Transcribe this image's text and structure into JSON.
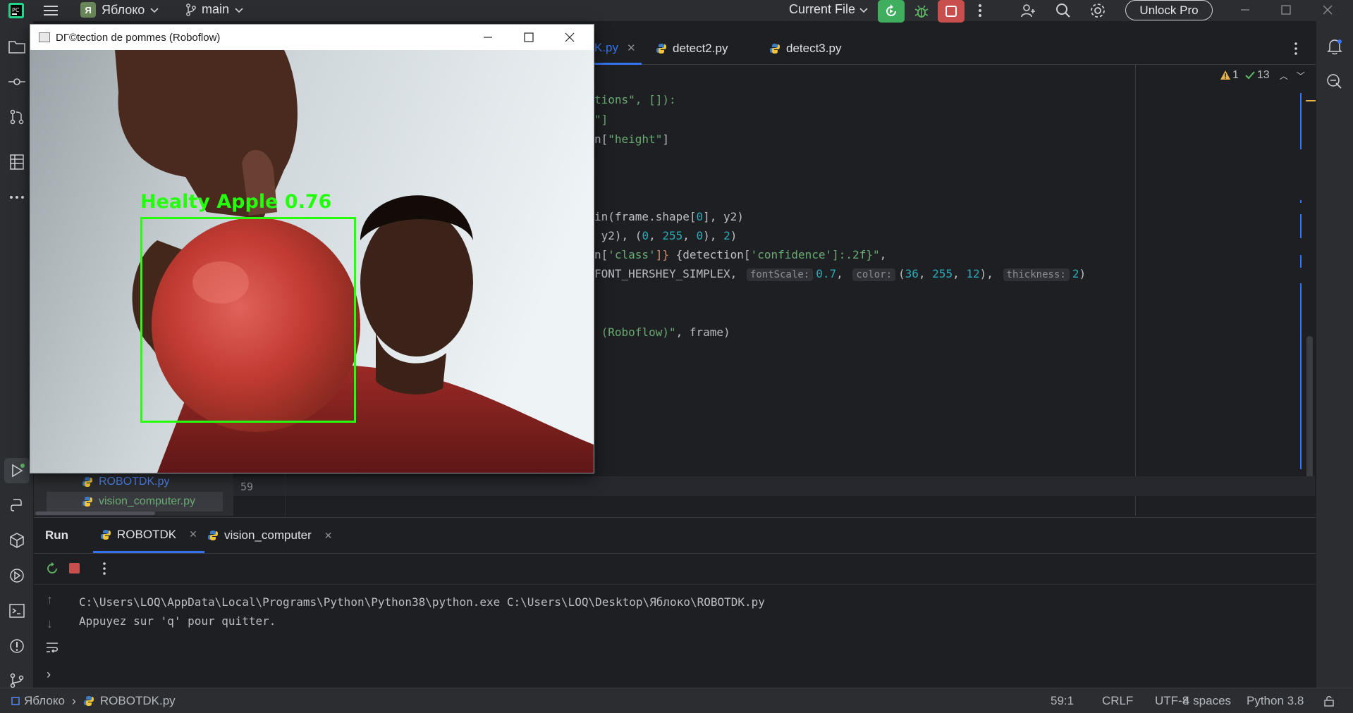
{
  "titlebar": {
    "project_initial": "Я",
    "project_name": "Яблоко",
    "branch": "main",
    "run_config": "Current File",
    "unlock_label": "Unlock Pro"
  },
  "editor": {
    "tabs": [
      {
        "label": "K.py"
      },
      {
        "label": "detect2.py"
      },
      {
        "label": "detect3.py"
      }
    ],
    "inspections": {
      "warnings": "1",
      "ok": "13"
    },
    "current_line_number": "59",
    "code": {
      "l1_a": "tions\", []):",
      "l2_a": "\"]",
      "l3_a": "n[",
      "l3_b": "\"height\"",
      "l3_c": "]",
      "l4_a": "in(frame.shape[",
      "l4_b": "0",
      "l4_c": "], y2)",
      "l5_a": " y2), (",
      "l5_b": "0",
      "l5_c": ", ",
      "l5_d": "255",
      "l5_e": ", ",
      "l5_f": "0",
      "l5_g": "), ",
      "l5_h": "2",
      "l5_i": ")",
      "l6_a": "n[",
      "l6_b": "'class'",
      "l6_c": "]}",
      "l6_d": " {detection[",
      "l6_e": "'confidence'",
      "l6_f": "]:.2f}\"",
      "l6_g": ",",
      "l7_a": "FONT_HERSHEY_SIMPLEX,",
      "l7_hint1": "fontScale:",
      "l7_v1": "0.7",
      "l7_sep1": ",",
      "l7_hint2": "color:",
      "l7_v2a": "(",
      "l7_v2b": "36",
      "l7_v2c": ", ",
      "l7_v2d": "255",
      "l7_v2e": ", ",
      "l7_v2f": "12",
      "l7_v2g": "),",
      "l7_hint3": "thickness:",
      "l7_v3": "2",
      "l7_end": ")",
      "l8_a": " (Roboflow)\"",
      "l8_b": ", frame)"
    }
  },
  "project": {
    "files": [
      {
        "name": "ROBOTDK.py"
      },
      {
        "name": "vision_computer.py"
      }
    ]
  },
  "run": {
    "title": "Run",
    "tabs": [
      {
        "label": "ROBOTDK"
      },
      {
        "label": "vision_computer"
      }
    ],
    "console": [
      "C:\\Users\\LOQ\\AppData\\Local\\Programs\\Python\\Python38\\python.exe C:\\Users\\LOQ\\Desktop\\Яблоко\\ROBOTDK.py",
      "Appuyez sur 'q' pour quitter."
    ]
  },
  "statusbar": {
    "project": "Яблоко",
    "file": "ROBOTDK.py",
    "position": "59:1",
    "line_sep": "CRLF",
    "encoding": "UTF-8",
    "indent": "4 spaces",
    "interpreter": "Python 3.8"
  },
  "cv_window": {
    "title": "DГ©tection de pommes (Roboflow)",
    "detection_label": "Healty Apple 0.76",
    "box_color": "#24ff0c"
  },
  "colors": {
    "run_green": "#3fae5e",
    "stop_red": "#c94f4f",
    "accent_blue": "#3574f0"
  }
}
